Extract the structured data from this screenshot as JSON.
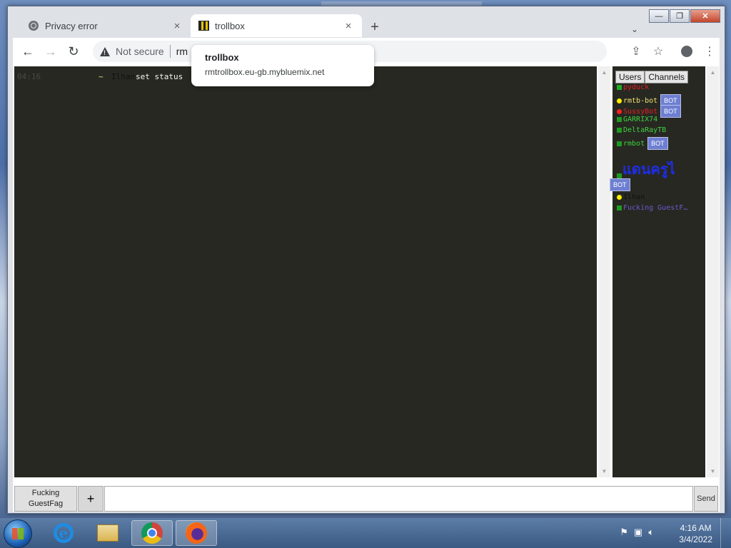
{
  "browser": {
    "tabs": [
      {
        "title": "Privacy error",
        "icon": "globe-icon",
        "close": "×"
      },
      {
        "title": "trollbox",
        "icon": "trollbox-favicon",
        "close": "×"
      }
    ],
    "new_tab": "+",
    "address": {
      "security_label": "Not secure",
      "url_prefix": "rm"
    },
    "hover_card": {
      "title": "trollbox",
      "url": "rmtrollbox.eu-gb.mybluemix.net"
    }
  },
  "chat": {
    "messages": [
      {
        "time": "04:16",
        "arrow": "~",
        "nick": "Ilhan",
        "text": "set status"
      }
    ]
  },
  "sidebar": {
    "tabs": [
      "Users",
      "Channels"
    ],
    "users": [
      {
        "name": "pyduck",
        "color": "#e02020",
        "marker": "#22aa22",
        "badge": ""
      },
      {
        "name": "rmtb-bot",
        "color": "#f0e070",
        "marker": "#ffee00",
        "badge": "BOT"
      },
      {
        "name": "SussyBot",
        "color": "#e02020",
        "marker": "#ff2020",
        "badge": "BOT"
      },
      {
        "name": "GARRIX74",
        "color": "#40d040",
        "marker": "#1f9a1f",
        "badge": ""
      },
      {
        "name": "DeltaRayTB",
        "color": "#40d040",
        "marker": "#1f9a1f",
        "badge": ""
      },
      {
        "name": "rmbot",
        "color": "#40d040",
        "marker": "#1f9a1f",
        "badge": "BOT"
      },
      {
        "name": "แดนครูไ",
        "color": "#1e2de8",
        "marker": "",
        "badge": ""
      },
      {
        "name": "",
        "color": "#40d040",
        "marker": "#1f9a1f",
        "badge": "BOT"
      },
      {
        "name": "Ilhan",
        "color": "#111111",
        "marker": "#ffee00",
        "badge": ""
      },
      {
        "name": "Fucking GuestF…",
        "color": "#6a5acd",
        "marker": "#1f9a1f",
        "badge": ""
      }
    ]
  },
  "composer": {
    "nick_line1": "Fucking",
    "nick_line2": "GuestFag",
    "add": "+",
    "message_value": "",
    "send": "Send"
  },
  "taskbar": {
    "apps": [
      "windows-start-icon",
      "ie-icon",
      "explorer-folder-icon",
      "chrome-icon",
      "firefox-icon"
    ],
    "time": "4:16 AM",
    "date": "3/4/2022"
  }
}
